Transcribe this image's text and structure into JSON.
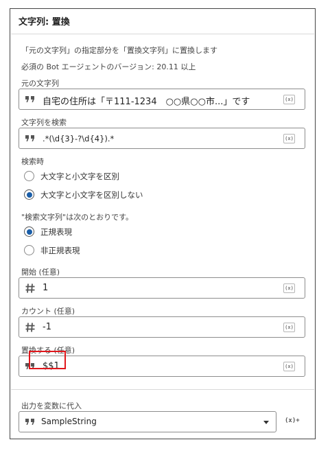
{
  "panel": {
    "title": "文字列: 置換",
    "description": "「元の文字列」の指定部分を「置換文字列」に置換します",
    "requirement": "必須の Bot エージェントのバージョン: 20.11 以上"
  },
  "source_string": {
    "label": "元の文字列",
    "value": "自宅の住所は「〒111-1234　○○県○○市...」です",
    "icon": "quote-icon"
  },
  "search_string": {
    "label": "文字列を検索",
    "value": ".*(\\d{3}-?\\d{4}).*",
    "icon": "quote-icon"
  },
  "case_option": {
    "label": "検索時",
    "options": [
      "大文字と小文字を区別",
      "大文字と小文字を区別しない"
    ],
    "selected": "大文字と小文字を区別しない"
  },
  "regex_option": {
    "label": "\"検索文字列\"は次のとおりです。",
    "options": [
      "正規表現",
      "非正規表現"
    ],
    "selected": "正規表現"
  },
  "start": {
    "label": "開始 (任意)",
    "value": "1",
    "icon": "hash-icon"
  },
  "count": {
    "label": "カウント (任意)",
    "value": "-1",
    "icon": "hash-icon"
  },
  "replace": {
    "label": "置換する (任意)",
    "value": "$$1",
    "icon": "quote-icon"
  },
  "output": {
    "label": "出力を変数に代入",
    "value": "SampleString",
    "icon": "quote-icon",
    "create_var_label": "(x)+"
  },
  "var_button_label": "(x)",
  "colors": {
    "radio_selected": "#1a5ea8",
    "highlight": "#e0161b",
    "border": "#8c8c8c"
  }
}
